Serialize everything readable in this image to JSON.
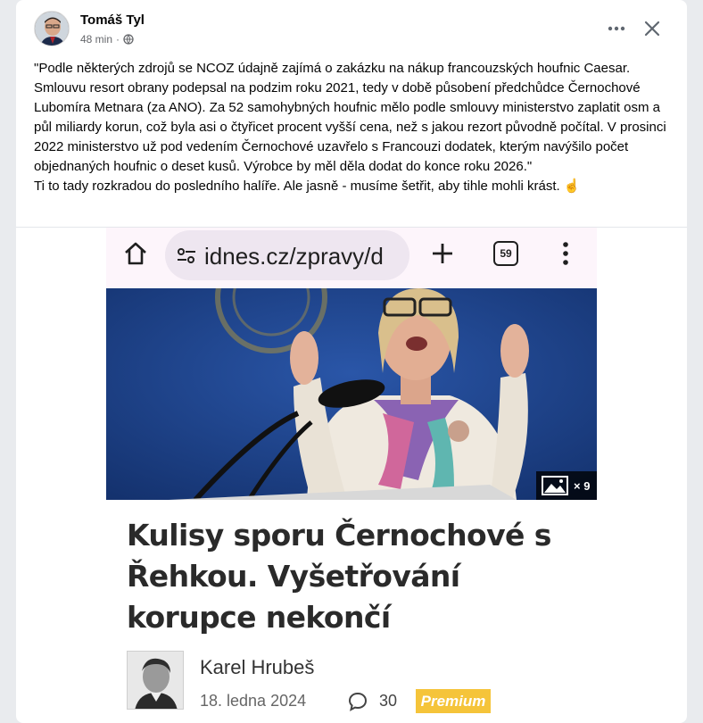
{
  "post": {
    "author": "Tomáš Tyl",
    "time": "48 min",
    "separator": "·",
    "paragraphs": [
      "\"Podle některých zdrojů se NCOZ údajně zajímá o zakázku na nákup francouzských houfnic Caesar. Smlouvu resort obrany podepsal na podzim roku 2021, tedy v době působení předchůdce Černochové Lubomíra Metnara (za ANO). Za 52 samohybných houfnic mělo podle smlouvy ministerstvo zaplatit osm a půl miliardy korun, což byla asi o čtyřicet procent vyšší cena, než s jakou rezort původně počítal. V prosinci 2022 ministerstvo už pod vedením Černochové uzavřelo s Francouzi dodatek, kterým navýšilo počet objednaných houfnic o deset kusů. Výrobce by měl děla dodat do konce roku 2026.\"",
      "Ti to tady rozkradou do posledního halíře. Ale jasně - musíme šetřit, aby tihle mohli krást. ☝"
    ]
  },
  "icons": {
    "privacy": "globe-icon",
    "more": "more-horizontal-icon",
    "close": "close-icon",
    "home": "home-icon",
    "site_settings": "tune-icon",
    "new_tab": "plus-icon",
    "tabs": "tabs-icon",
    "menu": "kebab-menu-icon",
    "gallery": "image-gallery-icon",
    "comments": "comment-bubble-icon"
  },
  "browser": {
    "url": "idnes.cz/zpravy/d",
    "tab_count": "59"
  },
  "article": {
    "gallery_count": "× 9",
    "headline": "Kulisy sporu Černochové s Řehkou. Vyšetřování korupce nekončí",
    "author": "Karel Hrubeš",
    "date": "18. ledna 2024",
    "comments": "30",
    "premium": "Premium"
  },
  "colors": {
    "card_bg": "#ffffff",
    "page_bg": "#e9ebee",
    "premium_bg": "#f5c43a",
    "photo_bg": "#1e3f85",
    "browserbar_bg": "#fdf5fb"
  }
}
